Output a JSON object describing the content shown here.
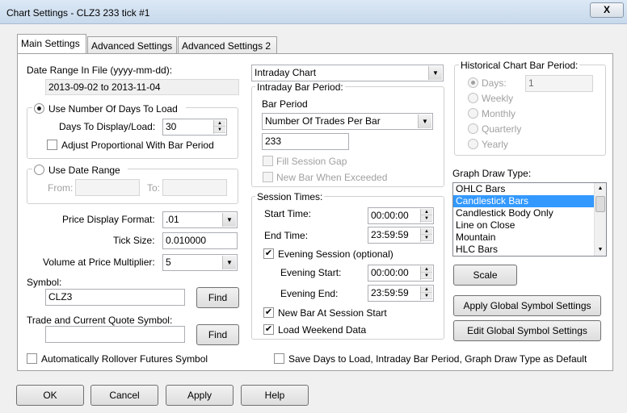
{
  "window": {
    "title": "Chart Settings - CLZ3  233 tick  #1",
    "close_symbol": "X"
  },
  "tabs": [
    "Main Settings",
    "Advanced Settings",
    "Advanced Settings 2"
  ],
  "left": {
    "date_range_label": "Date Range In File (yyyy-mm-dd):",
    "date_range_value": "2013-09-02 to 2013-11-04",
    "use_days_label": "Use Number Of Days To Load",
    "days_display_label": "Days To Display/Load:",
    "days_value": "30",
    "adjust_label": "Adjust Proportional With Bar Period",
    "use_date_range_label": "Use Date Range",
    "from_label": "From:",
    "to_label": "To:",
    "price_format_label": "Price Display Format:",
    "price_format_value": ".01",
    "tick_size_label": "Tick Size:",
    "tick_size_value": "0.010000",
    "volume_label": "Volume at Price Multiplier:",
    "volume_value": "5",
    "symbol_label": "Symbol:",
    "symbol_value": "CLZ3",
    "find_label": "Find",
    "trade_symbol_label": "Trade and Current Quote Symbol:",
    "trade_symbol_value": "",
    "rollover_label": "Automatically Rollover Futures Symbol"
  },
  "middle": {
    "chart_type_value": "Intraday Chart",
    "bar_period_group": "Intraday Bar Period:",
    "bar_period_label": "Bar Period",
    "bar_period_value": "Number Of Trades Per Bar",
    "bar_period_number": "233",
    "fill_gap_label": "Fill Session Gap",
    "new_bar_exceeded_label": "New Bar When Exceeded",
    "session_group": "Session Times:",
    "start_time_label": "Start Time:",
    "start_time_value": "00:00:00",
    "end_time_label": "End Time:",
    "end_time_value": "23:59:59",
    "evening_session_label": "Evening Session (optional)",
    "evening_start_label": "Evening Start:",
    "evening_start_value": "00:00:00",
    "evening_end_label": "Evening End:",
    "evening_end_value": "23:59:59",
    "new_bar_session_label": "New Bar At Session Start",
    "load_weekend_label": "Load Weekend Data",
    "save_default_label": "Save Days to Load, Intraday Bar Period, Graph Draw Type as Default"
  },
  "right": {
    "hist_group": "Historical Chart Bar Period:",
    "days_label": "Days:",
    "days_value": "1",
    "weekly_label": "Weekly",
    "monthly_label": "Monthly",
    "quarterly_label": "Quarterly",
    "yearly_label": "Yearly",
    "graph_draw_label": "Graph Draw Type:",
    "graph_items": [
      "OHLC Bars",
      "Candlestick Bars",
      "Candlestick Body Only",
      "Line on Close",
      "Mountain",
      "HLC Bars"
    ],
    "selected_item": "Candlestick Bars",
    "scale_label": "Scale",
    "apply_global_label": "Apply Global Symbol Settings",
    "edit_global_label": "Edit Global Symbol Settings"
  },
  "bottom": {
    "ok": "OK",
    "cancel": "Cancel",
    "apply": "Apply",
    "help": "Help"
  },
  "colors": {
    "selection": "#3399ff",
    "titlebar": "#dce8f5"
  }
}
